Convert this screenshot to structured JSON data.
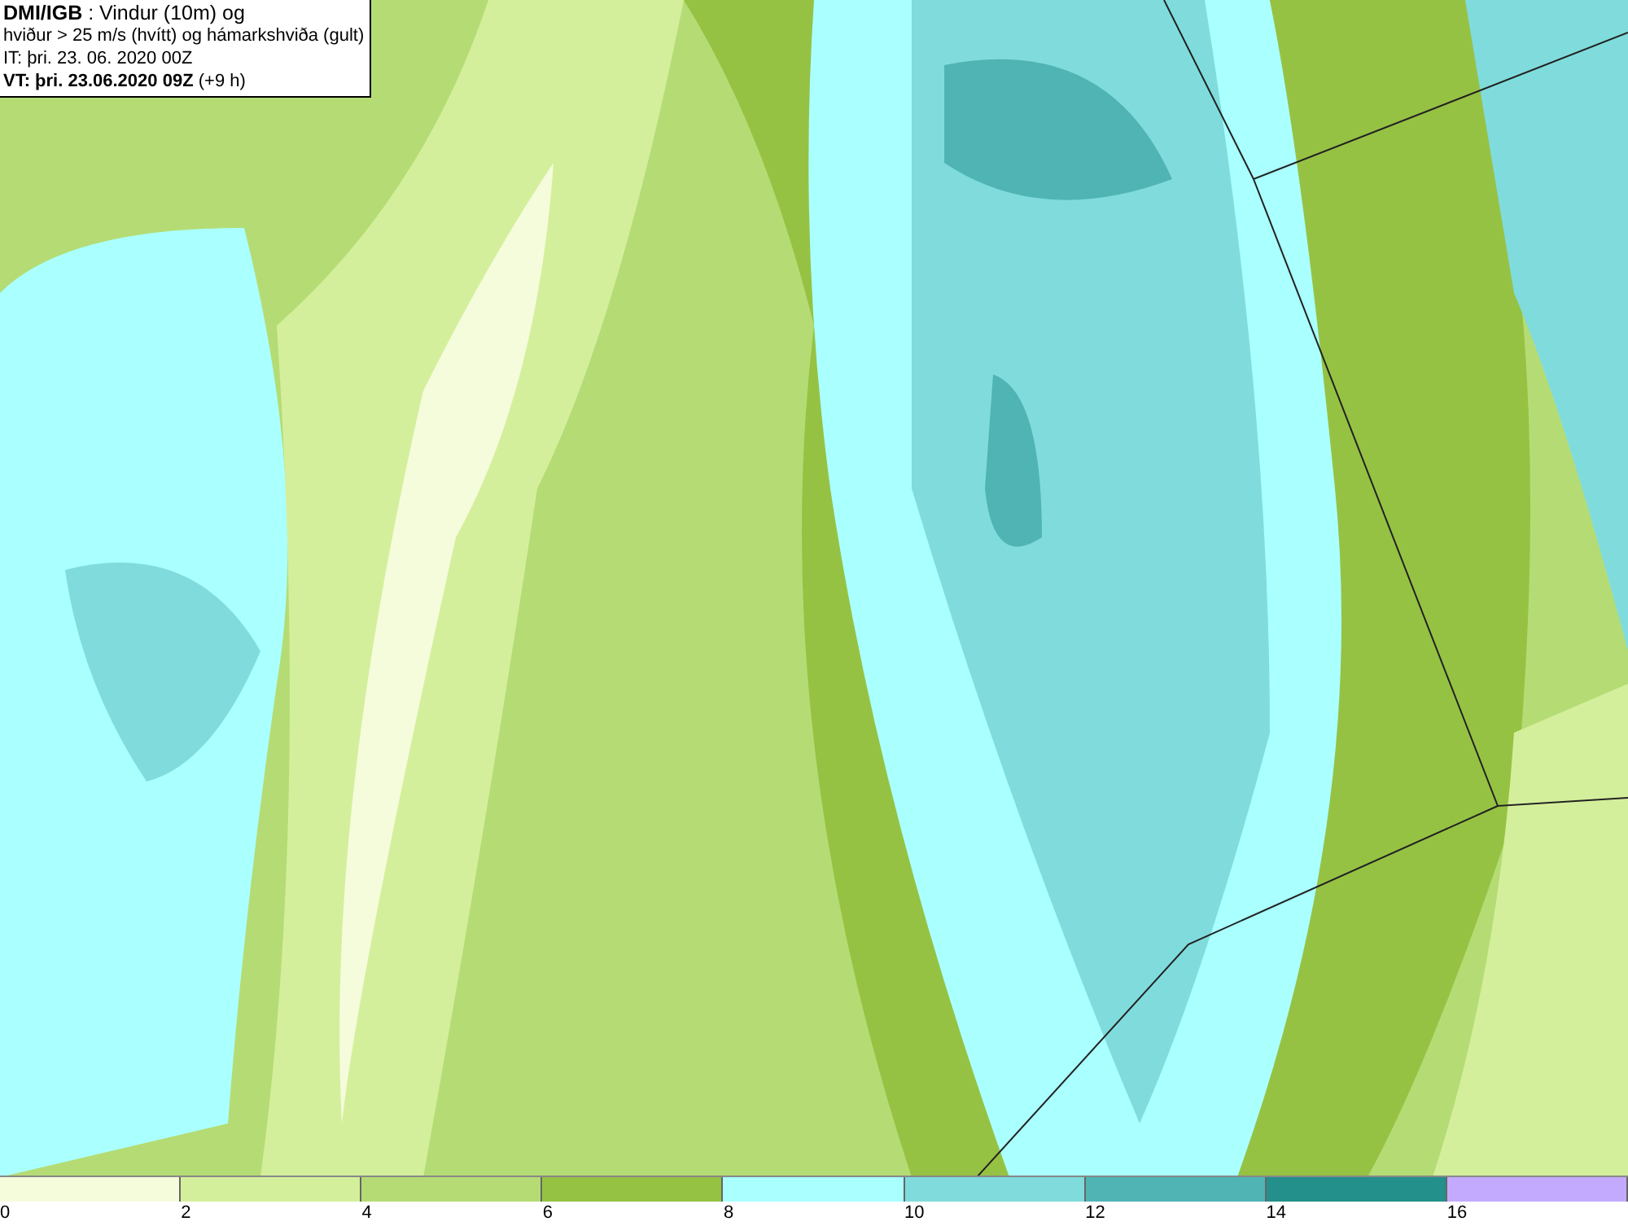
{
  "header": {
    "lines": [
      "**DMI/IGB** : Vindur (10m) og",
      "hviður > 25 m/s (hvítt) og hámarkshviða (gult)",
      "IT: þri. 23. 06. 2020 00Z",
      "**VT: þri. 23.06.2020 09Z** (+9 h)"
    ]
  },
  "legend": {
    "bins": [
      {
        "color": "#f5fcdc",
        "label": "0"
      },
      {
        "color": "#d4ef9c",
        "label": "2"
      },
      {
        "color": "#b5dc74",
        "label": "4"
      },
      {
        "color": "#96c244",
        "label": "6"
      },
      {
        "color": "#aaffff",
        "label": "8"
      },
      {
        "color": "#80dcdc",
        "label": "10"
      },
      {
        "color": "#50b4b4",
        "label": "12"
      },
      {
        "color": "#23908c",
        "label": "14"
      },
      {
        "color": "#c3aaff",
        "label": "16"
      }
    ]
  }
}
